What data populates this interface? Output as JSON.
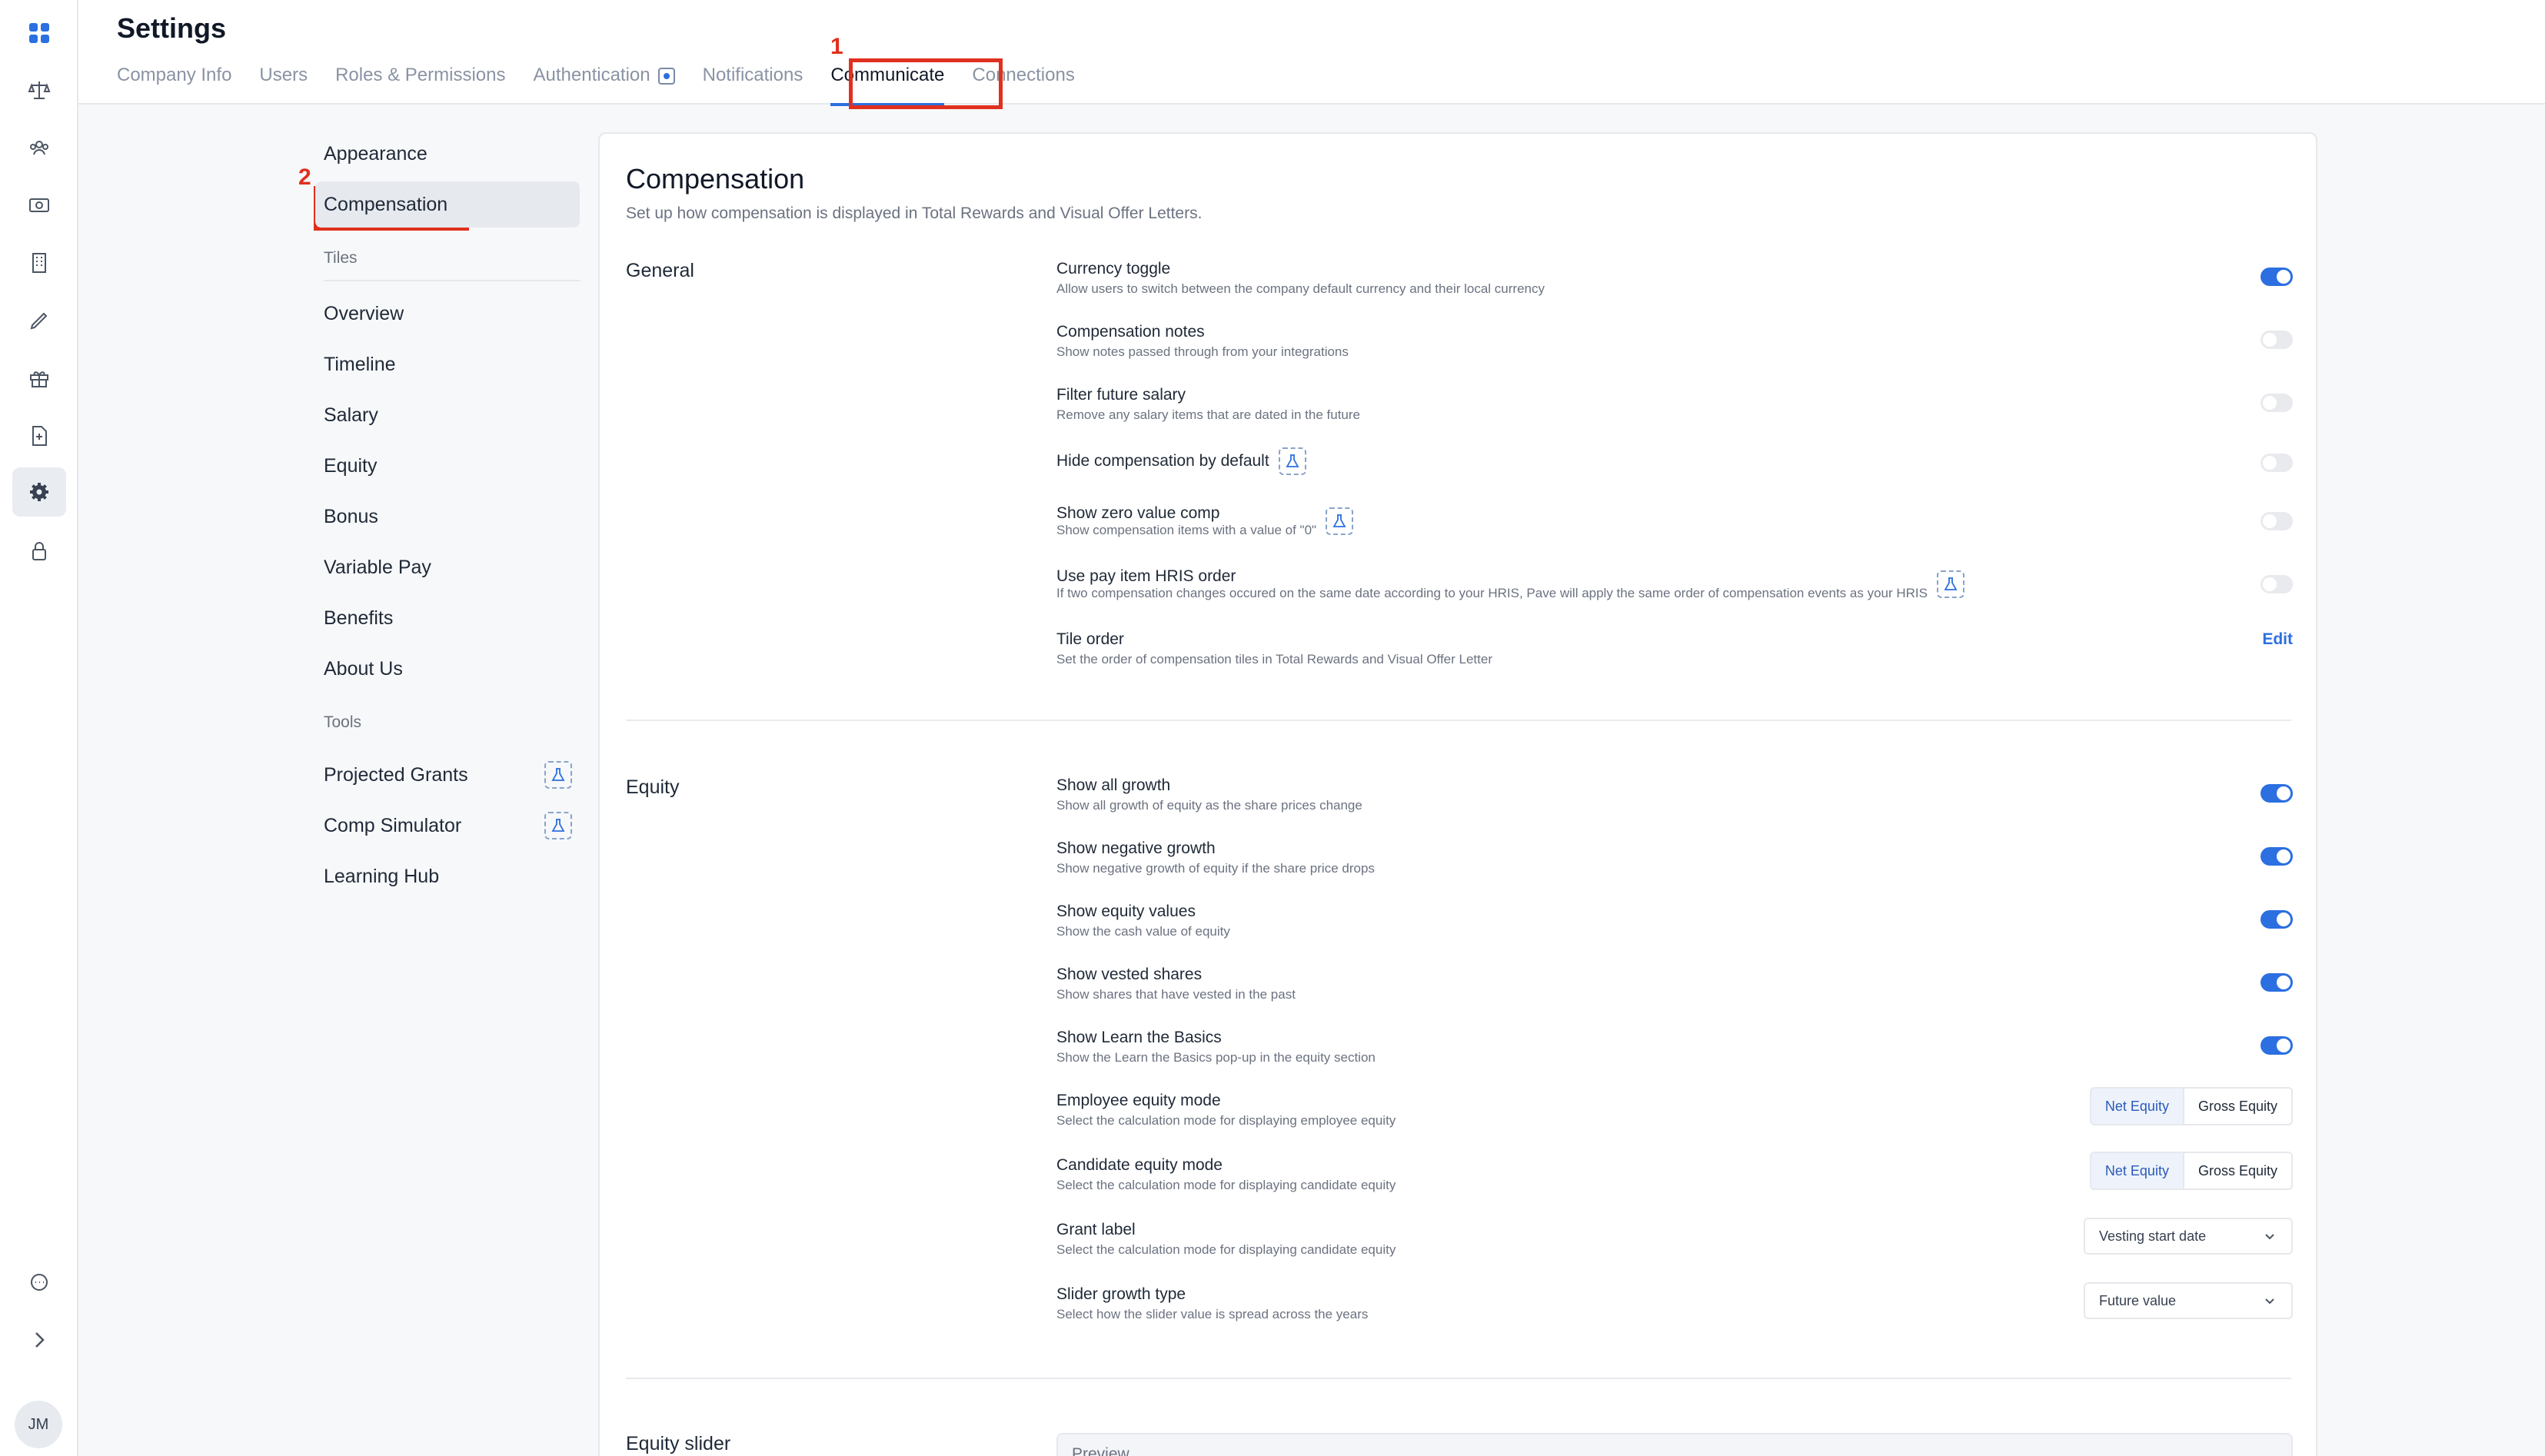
{
  "header": {
    "title": "Settings"
  },
  "tabs": [
    {
      "label": "Company Info"
    },
    {
      "label": "Users"
    },
    {
      "label": "Roles & Permissions"
    },
    {
      "label": "Authentication"
    },
    {
      "label": "Notifications"
    },
    {
      "label": "Communicate"
    },
    {
      "label": "Connections"
    }
  ],
  "annotations": {
    "one": "1",
    "two": "2"
  },
  "subnav": {
    "appearance": "Appearance",
    "compensation": "Compensation",
    "tiles_header": "Tiles",
    "tiles": [
      "Overview",
      "Timeline",
      "Salary",
      "Equity",
      "Bonus",
      "Variable Pay",
      "Benefits",
      "About Us"
    ],
    "tools_header": "Tools",
    "tools": [
      "Projected Grants",
      "Comp Simulator",
      "Learning Hub"
    ]
  },
  "card": {
    "title": "Compensation",
    "subtitle": "Set up how compensation is displayed in Total Rewards and Visual Offer Letters.",
    "general": {
      "label": "General",
      "rows": [
        {
          "title": "Currency toggle",
          "desc": "Allow users to switch between the company default currency and their local currency",
          "toggle": "on"
        },
        {
          "title": "Compensation notes",
          "desc": "Show notes passed through from your integrations",
          "toggle": "off"
        },
        {
          "title": "Filter future salary",
          "desc": "Remove any salary items that are dated in the future",
          "toggle": "off"
        },
        {
          "title": "Hide compensation by default",
          "desc": "",
          "toggle": "off"
        },
        {
          "title": "Show zero value comp",
          "desc": "Show compensation items with a value of \"0\"",
          "toggle": "off"
        },
        {
          "title": "Use pay item HRIS order",
          "desc": "If two compensation changes occured on the same date according to your HRIS, Pave will apply the same order of compensation events as your HRIS",
          "toggle": "off"
        },
        {
          "title": "Tile order",
          "desc": "Set the order of compensation tiles in Total Rewards and Visual Offer Letter",
          "action": "Edit"
        }
      ]
    },
    "equity": {
      "label": "Equity",
      "rows": [
        {
          "title": "Show all growth",
          "desc": "Show all growth of equity as the share prices change",
          "toggle": "on"
        },
        {
          "title": "Show negative growth",
          "desc": "Show negative growth of equity if the share price drops",
          "toggle": "on"
        },
        {
          "title": "Show equity values",
          "desc": "Show the cash value of equity",
          "toggle": "on"
        },
        {
          "title": "Show vested shares",
          "desc": "Show shares that have vested in the past",
          "toggle": "on"
        },
        {
          "title": "Show Learn the Basics",
          "desc": "Show the Learn the Basics pop-up in the equity section",
          "toggle": "on"
        },
        {
          "title": "Employee equity mode",
          "desc": "Select the calculation mode for displaying employee equity",
          "options": [
            "Net Equity",
            "Gross Equity"
          ],
          "selected": "Net Equity"
        },
        {
          "title": "Candidate equity mode",
          "desc": "Select the calculation mode for displaying candidate equity",
          "options": [
            "Net Equity",
            "Gross Equity"
          ],
          "selected": "Net Equity"
        },
        {
          "title": "Grant label",
          "desc": "Select the calculation mode for displaying candidate equity",
          "value": "Vesting start date"
        },
        {
          "title": "Slider growth type",
          "desc": "Select how the slider value is spread across the years",
          "value": "Future value"
        }
      ]
    },
    "equity_slider": {
      "label": "Equity slider",
      "preview_label": "Preview"
    }
  },
  "user": {
    "initials": "JM"
  },
  "colors": {
    "accent": "#2b6fe0",
    "annotation": "#e0301e"
  }
}
